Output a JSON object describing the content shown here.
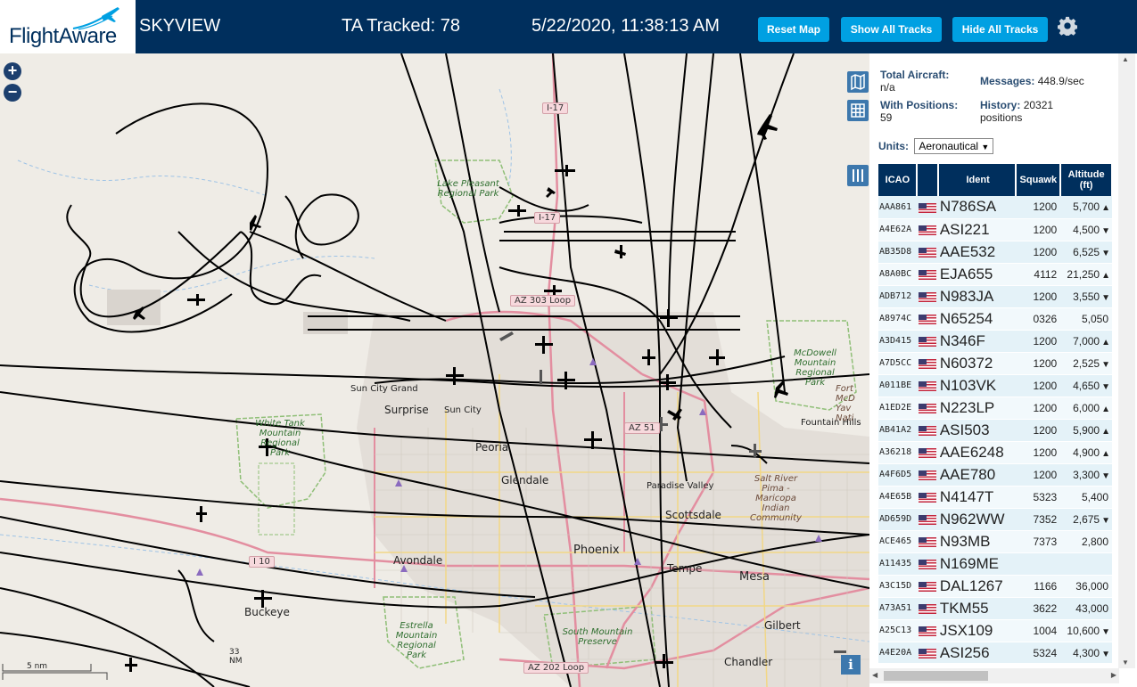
{
  "header": {
    "logo_text": "FlightAware",
    "app_name": "SKYVIEW",
    "tracked": "TA Tracked: 78",
    "clock": "5/22/2020, 11:38:13 AM",
    "buttons": {
      "reset": "Reset Map",
      "show": "Show All Tracks",
      "hide": "Hide All Tracks"
    },
    "settings_icon": "gear-icon",
    "bg_color": "#002f5d",
    "button_color": "#00a0e2"
  },
  "map": {
    "zoom_in": "+",
    "zoom_out": "−",
    "tool_icons": [
      "map-layers-icon",
      "grid-icon",
      "columns-icon"
    ],
    "scale_top": "5 nm",
    "scale_bottom": "33 NM",
    "info_label": "i",
    "cities": {
      "phoenix": "Phoenix",
      "peoria": "Peoria",
      "glendale": "Glendale",
      "scottsdale": "Scottsdale",
      "paradise_valley": "Paradise Valley",
      "tempe": "Tempe",
      "mesa": "Mesa",
      "gilbert": "Gilbert",
      "chandler": "Chandler",
      "avondale": "Avondale",
      "buckeye": "Buckeye",
      "surprise": "Surprise",
      "sun_city": "Sun City",
      "sun_city_grand": "Sun City Grand",
      "fountain_hills": "Fountain Hills"
    },
    "parks": {
      "lake_pleasant": "Lake Pleasant Regional Park",
      "white_tank": "White Tank Mountain Regional Park",
      "mcdowell": "McDowell Mountain Regional Park",
      "estrella": "Estrella Mountain Regional Park",
      "south_mountain": "South Mountain Preserve",
      "salt_river": "Salt River Pima - Maricopa Indian Community",
      "fort_mcd": "Fort McD Yav Nati"
    },
    "shields": {
      "i17": "I-17",
      "i17b": "I-17",
      "az303": "AZ 303 Loop",
      "az51": "AZ 51",
      "i10": "I 10",
      "az202": "AZ 202 Loop"
    }
  },
  "panel": {
    "total_aircraft_label": "Total Aircraft:",
    "total_aircraft_value": "n/a",
    "messages_label": "Messages:",
    "messages_value": "448.9/sec",
    "with_positions_label": "With Positions:",
    "with_positions_value": "59",
    "history_label": "History:",
    "history_value": "20321",
    "history_unit": "positions",
    "units_label": "Units:",
    "units_value": "Aeronautical",
    "table_headers": {
      "icao": "ICAO",
      "ident": "Ident",
      "squawk": "Squawk",
      "altitude": "Altitude (ft)"
    },
    "rows": [
      {
        "icao": "AAA861",
        "ident": "N786SA",
        "squawk": "1200",
        "alt": "5,700",
        "trend": "▲"
      },
      {
        "icao": "A4E62A",
        "ident": "ASI221",
        "squawk": "1200",
        "alt": "4,500",
        "trend": "▼"
      },
      {
        "icao": "AB35D8",
        "ident": "AAE532",
        "squawk": "1200",
        "alt": "6,525",
        "trend": "▼"
      },
      {
        "icao": "A8A0BC",
        "ident": "EJA655",
        "squawk": "4112",
        "alt": "21,250",
        "trend": "▲"
      },
      {
        "icao": "ADB712",
        "ident": "N983JA",
        "squawk": "1200",
        "alt": "3,550",
        "trend": "▼"
      },
      {
        "icao": "A8974C",
        "ident": "N65254",
        "squawk": "0326",
        "alt": "5,050",
        "trend": ""
      },
      {
        "icao": "A3D415",
        "ident": "N346F",
        "squawk": "1200",
        "alt": "7,000",
        "trend": "▲"
      },
      {
        "icao": "A7D5CC",
        "ident": "N60372",
        "squawk": "1200",
        "alt": "2,525",
        "trend": "▼"
      },
      {
        "icao": "A011BE",
        "ident": "N103VK",
        "squawk": "1200",
        "alt": "4,650",
        "trend": "▼"
      },
      {
        "icao": "A1ED2E",
        "ident": "N223LP",
        "squawk": "1200",
        "alt": "6,000",
        "trend": "▲"
      },
      {
        "icao": "AB41A2",
        "ident": "ASI503",
        "squawk": "1200",
        "alt": "5,900",
        "trend": "▲"
      },
      {
        "icao": "A36218",
        "ident": "AAE6248",
        "squawk": "1200",
        "alt": "4,900",
        "trend": "▲"
      },
      {
        "icao": "A4F6D5",
        "ident": "AAE780",
        "squawk": "1200",
        "alt": "3,300",
        "trend": "▼"
      },
      {
        "icao": "A4E65B",
        "ident": "N4147T",
        "squawk": "5323",
        "alt": "5,400",
        "trend": ""
      },
      {
        "icao": "AD659D",
        "ident": "N962WW",
        "squawk": "7352",
        "alt": "2,675",
        "trend": "▼"
      },
      {
        "icao": "ACE465",
        "ident": "N93MB",
        "squawk": "7373",
        "alt": "2,800",
        "trend": ""
      },
      {
        "icao": "A11435",
        "ident": "N169ME",
        "squawk": "",
        "alt": "",
        "trend": ""
      },
      {
        "icao": "A3C15D",
        "ident": "DAL1267",
        "squawk": "1166",
        "alt": "36,000",
        "trend": ""
      },
      {
        "icao": "A73A51",
        "ident": "TKM55",
        "squawk": "3622",
        "alt": "43,000",
        "trend": ""
      },
      {
        "icao": "A25C13",
        "ident": "JSX109",
        "squawk": "1004",
        "alt": "10,600",
        "trend": "▼"
      },
      {
        "icao": "A4E20A",
        "ident": "ASI256",
        "squawk": "5324",
        "alt": "4,300",
        "trend": "▼"
      }
    ]
  }
}
